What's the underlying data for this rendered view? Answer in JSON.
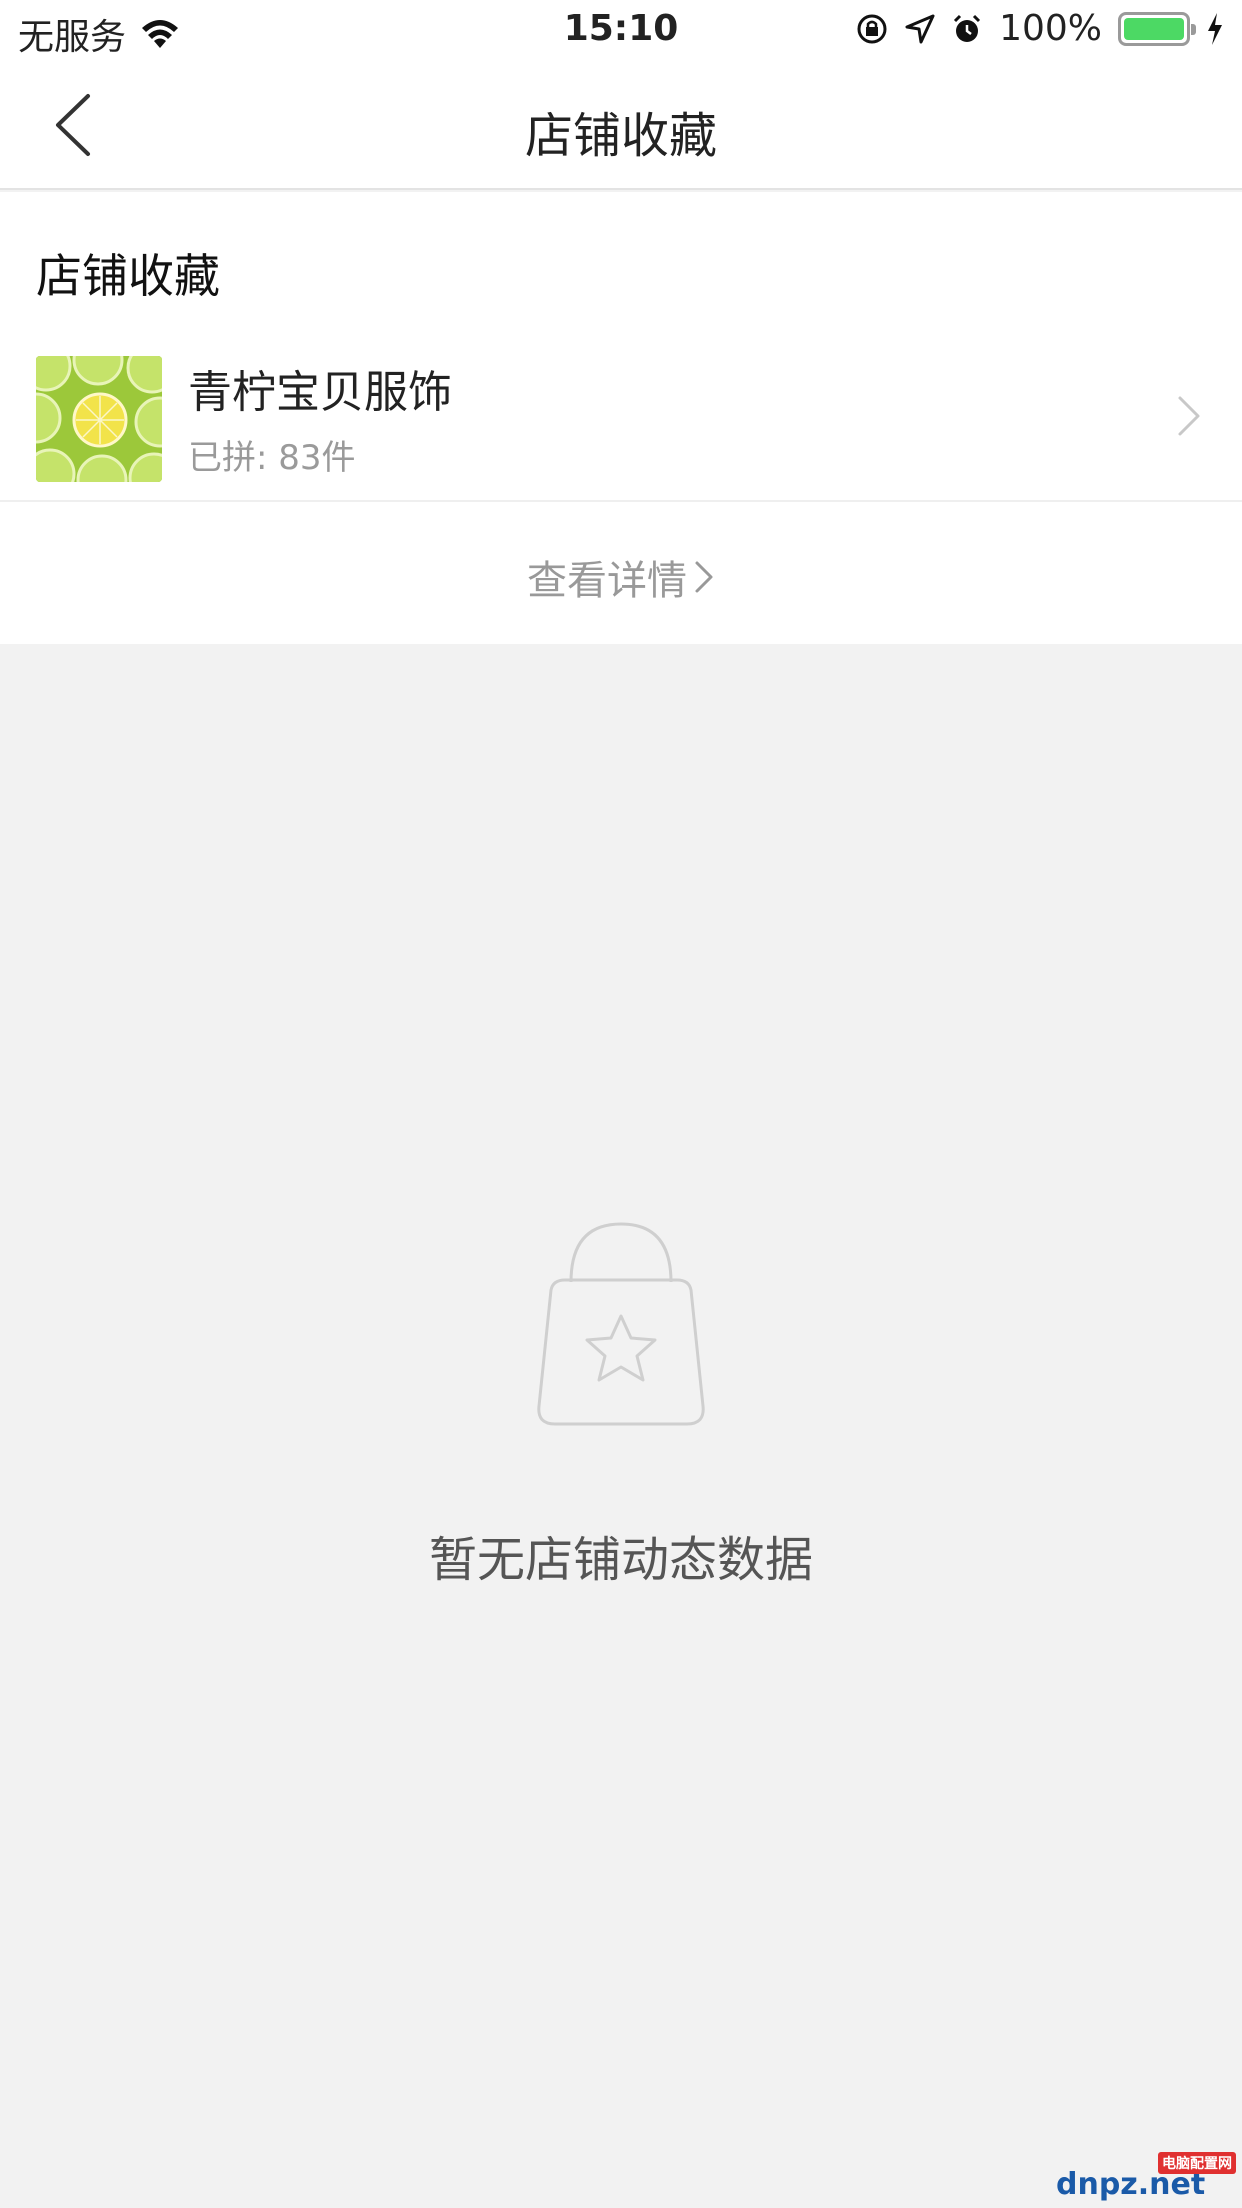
{
  "status_bar": {
    "carrier": "无服务",
    "time": "15:10",
    "battery_percent": "100%",
    "battery_level": 1.0,
    "icons": [
      "wifi-icon",
      "orientation-lock-icon",
      "location-icon",
      "alarm-icon",
      "battery-icon",
      "charging-icon"
    ]
  },
  "nav": {
    "title": "店铺收藏",
    "back_icon": "chevron-left-icon"
  },
  "favorites": {
    "section_title": "店铺收藏",
    "shops": [
      {
        "name": "青柠宝贝服饰",
        "meta": "已拼: 83件",
        "thumb": "lime-slices-image"
      }
    ],
    "details_label": "查看详情"
  },
  "empty_state": {
    "icon": "shopping-bag-star-icon",
    "text": "暂无店铺动态数据"
  },
  "watermark": {
    "text": "dnpz.net",
    "tag": "电脑配置网"
  },
  "colors": {
    "background": "#f2f2f2",
    "surface": "#ffffff",
    "battery_fill": "#4cd964",
    "muted_text": "#999999"
  }
}
